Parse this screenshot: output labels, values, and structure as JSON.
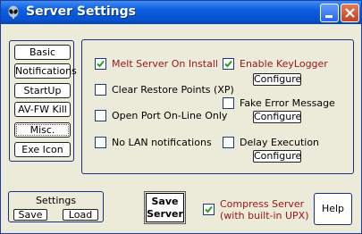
{
  "window": {
    "title": "Server Settings",
    "minimize_icon": "minimize-icon",
    "close_icon": "close-icon",
    "app_icon": "alien-icon"
  },
  "nav": {
    "items": [
      {
        "label": "Basic"
      },
      {
        "label": "Notifications"
      },
      {
        "label": "StartUp"
      },
      {
        "label": "AV-FW Kill"
      },
      {
        "label": "Misc.",
        "selected": true
      },
      {
        "label": "Exe Icon"
      }
    ]
  },
  "options": {
    "melt_server": {
      "label": "Melt Server On Install",
      "checked": true
    },
    "clear_restore": {
      "label": "Clear Restore Points (XP)",
      "checked": false
    },
    "open_port": {
      "label": "Open Port On-Line Only",
      "checked": false
    },
    "no_lan": {
      "label": "No LAN notifications",
      "checked": false
    },
    "keylogger": {
      "label": "Enable KeyLogger",
      "checked": true,
      "configure_label": "Configure"
    },
    "fake_error": {
      "label": "Fake Error Message",
      "checked": false,
      "configure_label": "Configure"
    },
    "delay_exec": {
      "label": "Delay Execution",
      "checked": false,
      "configure_label": "Configure"
    }
  },
  "settings": {
    "title": "Settings",
    "save_label": "Save",
    "load_label": "Load"
  },
  "footer": {
    "save_server_line1": "Save",
    "save_server_line2": "Server",
    "compress_line1": "Compress Server",
    "compress_line2": "(with built-in UPX)",
    "compress_checked": true,
    "help_label": "Help"
  },
  "colors": {
    "titlebar": "#0853d0",
    "window_bg": "#ecead8",
    "checked_label": "#9b1414",
    "check_mark": "#21a121"
  }
}
